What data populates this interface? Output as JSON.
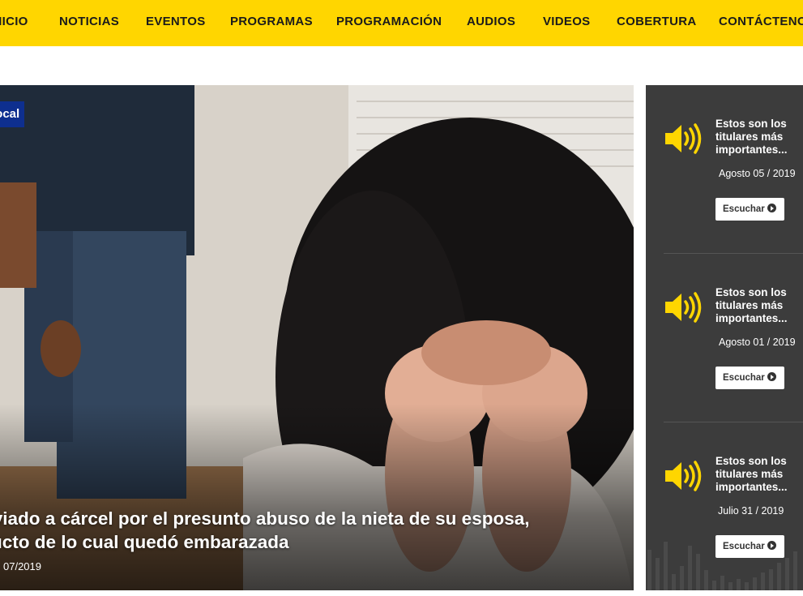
{
  "nav": {
    "items": [
      "INICIO",
      "NOTICIAS",
      "EVENTOS",
      "PROGRAMAS",
      "PROGRAMACIÓN",
      "AUDIOS",
      "VIDEOS",
      "COBERTURA",
      "CONTÁCTENOS"
    ]
  },
  "hero": {
    "category": "Local",
    "title_line1": "Enviado a cárcel por el presunto abuso de la nieta de su esposa,",
    "title_line2": "producto de lo cual quedó embarazada",
    "date": "07/2019"
  },
  "audios": [
    {
      "title": "Estos son los titulares más importantes...",
      "date": "Agosto 05 / 2019",
      "button": "Escuchar"
    },
    {
      "title": "Estos son los titulares más importantes...",
      "date": "Agosto 01 / 2019",
      "button": "Escuchar"
    },
    {
      "title": "Estos son los titulares más importantes...",
      "date": "Julio 31 / 2019",
      "button": "Escuchar"
    }
  ],
  "colors": {
    "nav_bg": "#ffd600",
    "badge_bg": "#0e2f8f",
    "panel_bg": "#3c3c3c",
    "speaker": "#ffd600"
  },
  "icons": [
    "speaker-icon",
    "play-circle-icon"
  ]
}
